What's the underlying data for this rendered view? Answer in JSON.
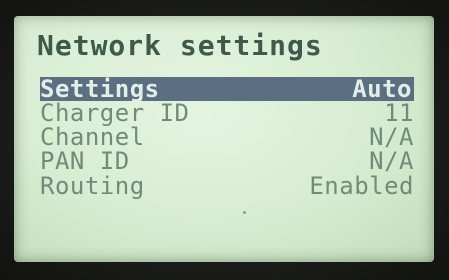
{
  "screen": {
    "title": "Network settings"
  },
  "menu": {
    "items": [
      {
        "label": "Settings",
        "value": "Auto",
        "selected": true
      },
      {
        "label": "Charger ID",
        "value": "11",
        "selected": false
      },
      {
        "label": "Channel",
        "value": "N/A",
        "selected": false
      },
      {
        "label": "PAN ID",
        "value": "N/A",
        "selected": false
      },
      {
        "label": "Routing",
        "value": "Enabled",
        "selected": false
      }
    ]
  },
  "colors": {
    "lcd_background": "#d6ecd0",
    "text": "#6f8c7b",
    "title_text": "#3e5a4b",
    "selection_bar": "#5a6f82",
    "selection_text": "#e3efe6",
    "bezel": "#1c1e1b"
  }
}
